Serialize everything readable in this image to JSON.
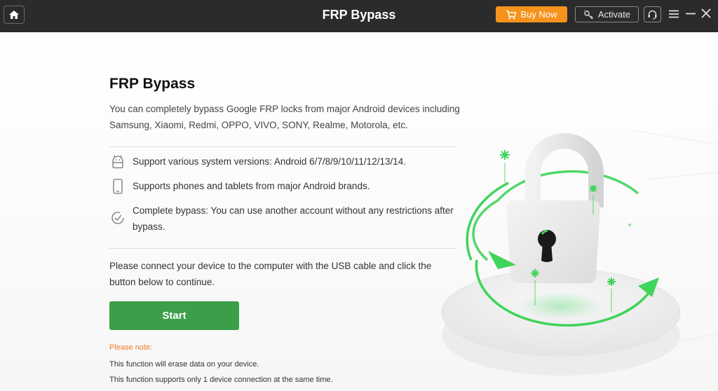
{
  "titlebar": {
    "title": "FRP Bypass",
    "buy_now_label": "Buy Now",
    "activate_label": "Activate"
  },
  "main": {
    "heading": "FRP Bypass",
    "description": "You can completely bypass Google FRP locks from major Android devices including Samsung, Xiaomi, Redmi, OPPO, VIVO, SONY, Realme, Motorola, etc.",
    "features": [
      {
        "icon": "android-icon",
        "text": "Support various system versions: Android 6/7/8/9/10/11/12/13/14."
      },
      {
        "icon": "phone-icon",
        "text": "Supports phones and tablets from major Android brands."
      },
      {
        "icon": "check-circle-icon",
        "text": "Complete bypass: You can use another account without any restrictions after bypass."
      }
    ],
    "connect_text": "Please connect your device to the computer with the USB cable and click the button below to continue.",
    "start_label": "Start",
    "note": {
      "title": "Please note:",
      "lines": [
        "This function will erase data on your device.",
        "This function supports only 1 device connection at the same time."
      ]
    }
  },
  "colors": {
    "titlebar_bg": "#2b2b2b",
    "buy_now_bg": "#f5931d",
    "start_bg": "#3d9e4a",
    "note_color": "#f07d2a",
    "accent_green": "#3fd45a"
  }
}
